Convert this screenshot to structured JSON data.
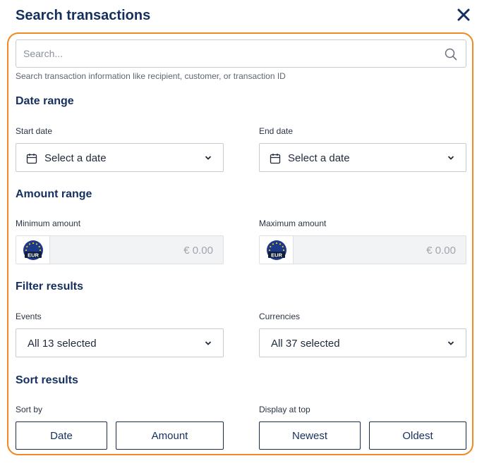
{
  "header": {
    "title": "Search transactions"
  },
  "search": {
    "placeholder": "Search...",
    "hint": "Search transaction information like recipient, customer, or transaction ID"
  },
  "date_range": {
    "title": "Date range",
    "start_label": "Start date",
    "start_value": "Select a date",
    "end_label": "End date",
    "end_value": "Select a date"
  },
  "amount_range": {
    "title": "Amount range",
    "min_label": "Minimum amount",
    "min_placeholder": "€ 0.00",
    "max_label": "Maximum amount",
    "max_placeholder": "€ 0.00",
    "currency_code": "EUR"
  },
  "filter": {
    "title": "Filter results",
    "events_label": "Events",
    "events_value": "All 13 selected",
    "currencies_label": "Currencies",
    "currencies_value": "All 37 selected"
  },
  "sort": {
    "title": "Sort results",
    "sort_by_label": "Sort by",
    "date_label": "Date",
    "amount_label": "Amount",
    "display_label": "Display at top",
    "newest_label": "Newest",
    "oldest_label": "Oldest"
  },
  "colors": {
    "accent_outline": "#f08a24",
    "heading": "#15305e",
    "eu_blue": "#1d3a8a",
    "eu_star": "#f5c518"
  }
}
